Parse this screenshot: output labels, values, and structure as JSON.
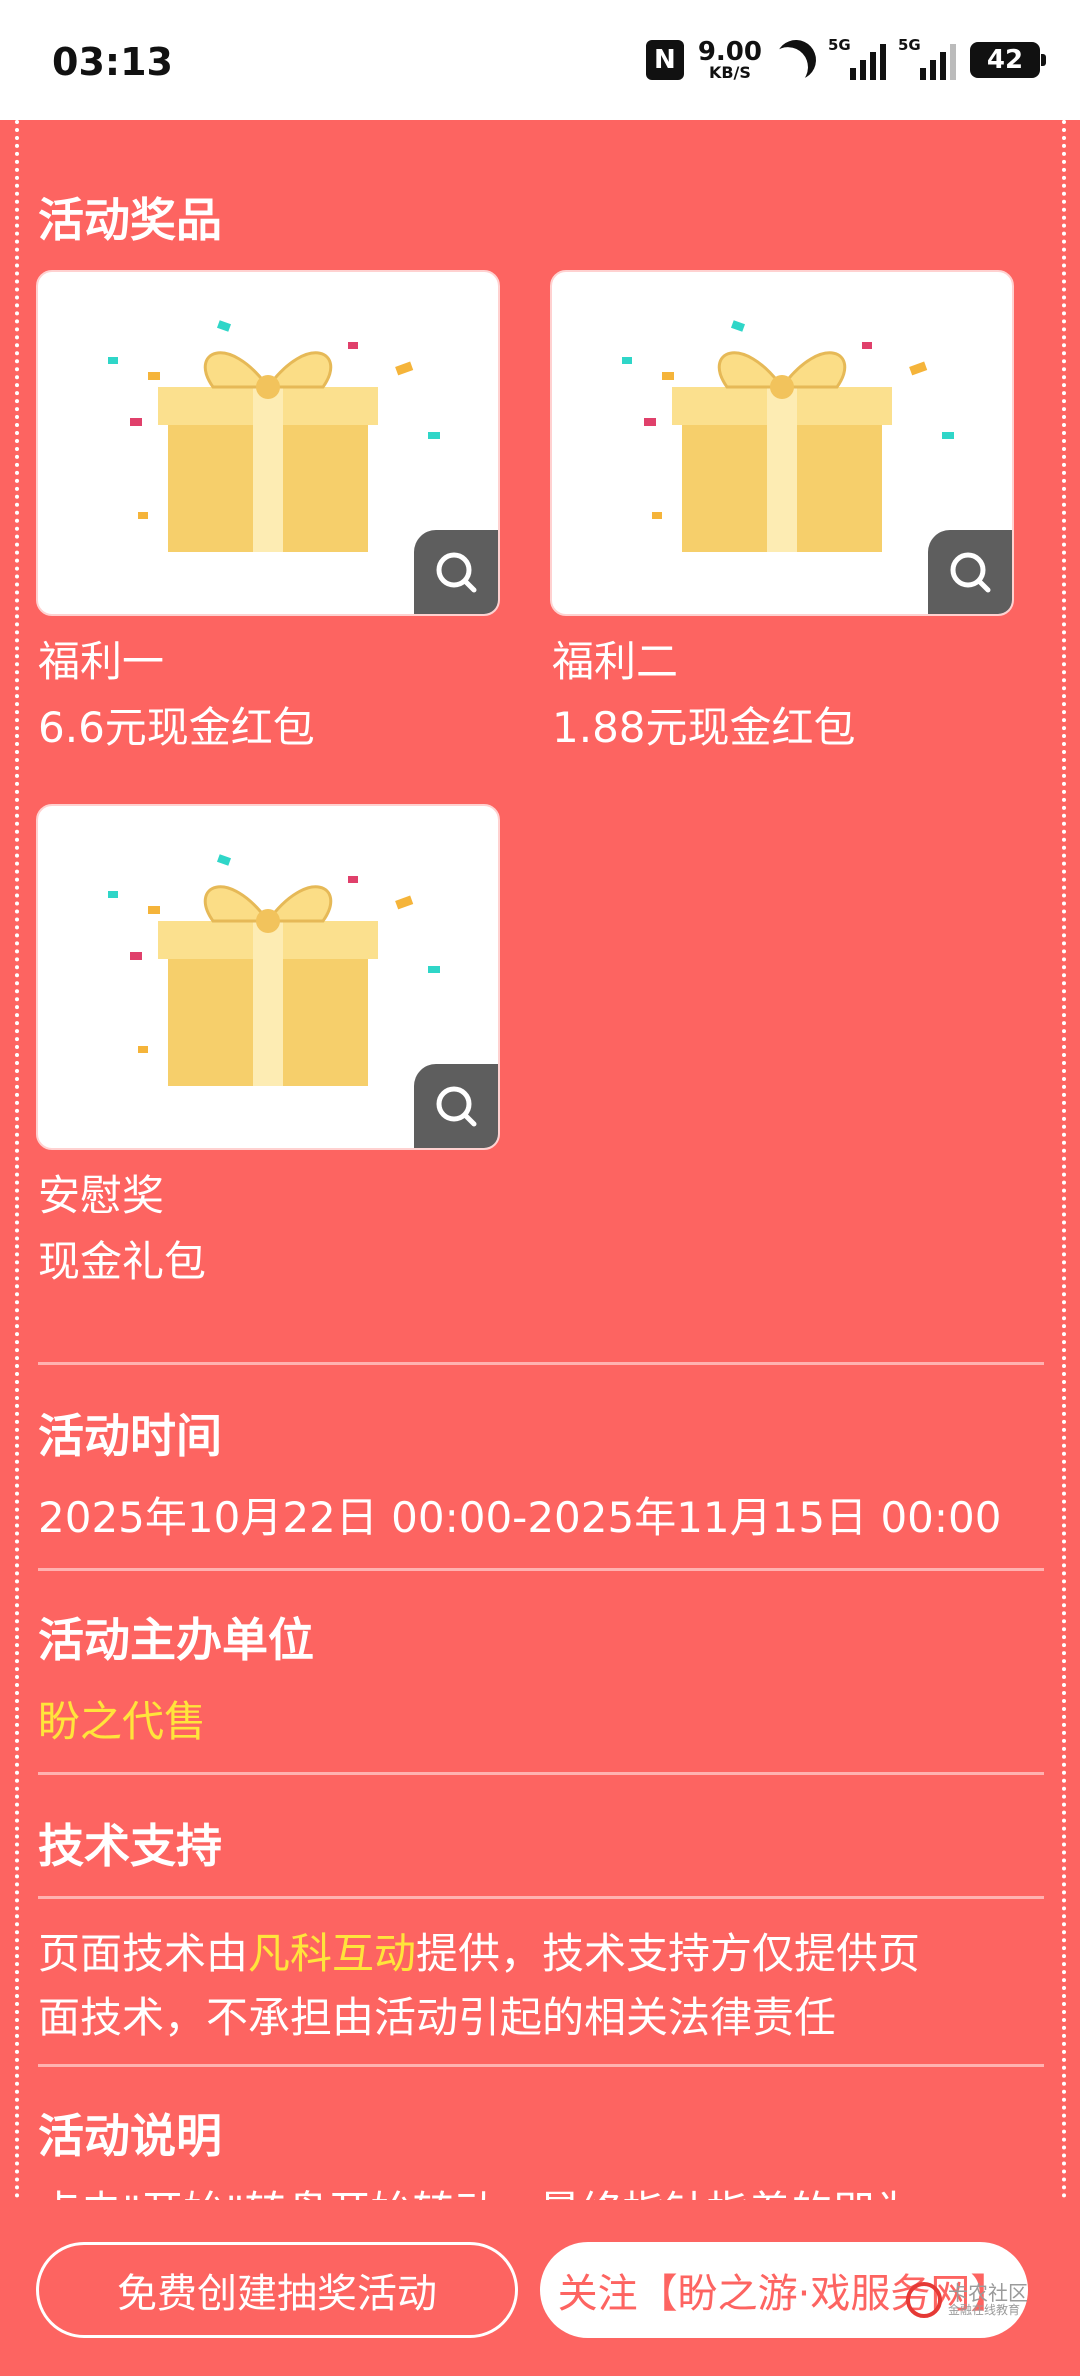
{
  "status_bar": {
    "time": "03:13",
    "nfc": "N",
    "speed_value": "9.00",
    "speed_unit": "KB/S",
    "signal1_label": "5G",
    "signal2_label": "5G",
    "battery": "42"
  },
  "prizes": {
    "title": "活动奖品",
    "items": [
      {
        "name": "福利一",
        "desc": "6.6元现金红包"
      },
      {
        "name": "福利二",
        "desc": "1.88元现金红包"
      },
      {
        "name": "安慰奖",
        "desc": "现金礼包"
      }
    ]
  },
  "time_section": {
    "title": "活动时间",
    "value": "2025年10月22日 00:00-2025年11月15日 00:00"
  },
  "organizer": {
    "title": "活动主办单位",
    "value": "盼之代售"
  },
  "tech": {
    "title": "技术支持",
    "text_prefix": "页面技术由",
    "highlight": "凡科互动",
    "text_suffix_line1": "提供，技术支持方仅提供页",
    "text_line2": "面技术，不承担由活动引起的相关法律责任"
  },
  "description": {
    "title": "活动说明",
    "partial_text": "点击\"开始\"转盘开始转动，最终指针指着的即为"
  },
  "bottom_bar": {
    "create_label": "免费创建抽奖活动",
    "follow_label": "关注【盼之游·戏服务网】"
  },
  "watermark": {
    "brand": "卡农社区",
    "sub": "金融在线教育"
  },
  "colors": {
    "panel": "#fd6461",
    "highlight": "#ffe43b"
  }
}
